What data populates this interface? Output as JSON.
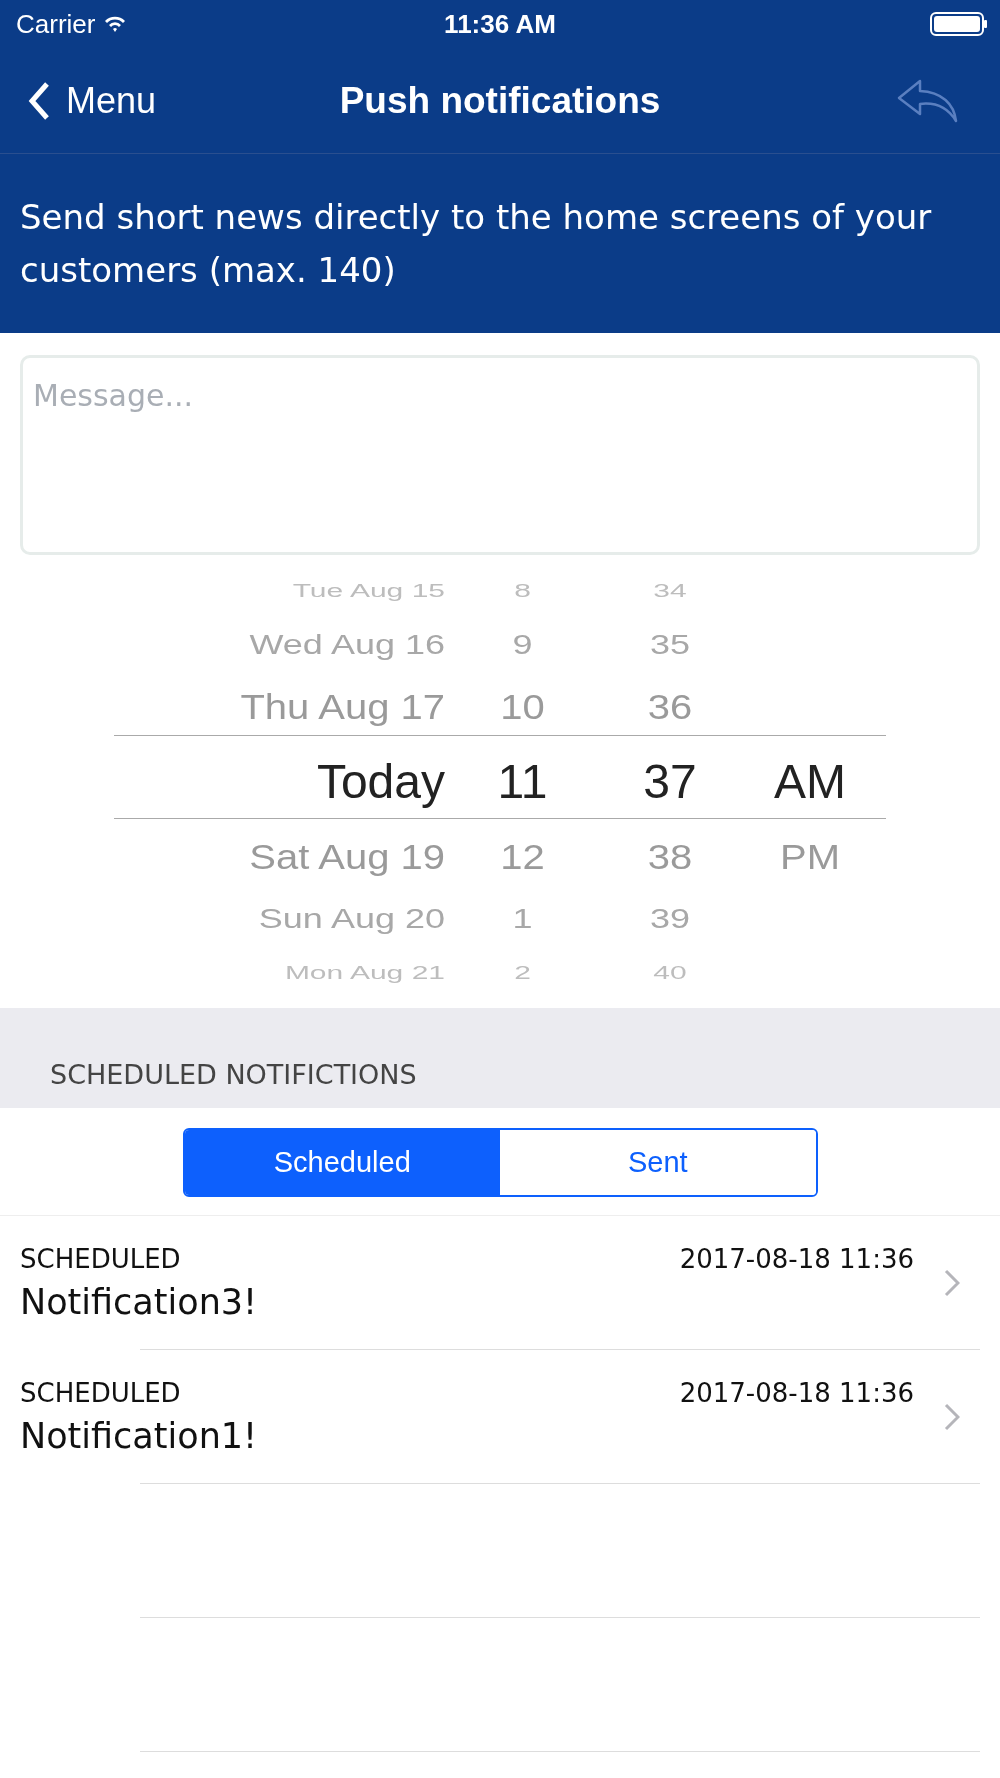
{
  "status_bar": {
    "carrier": "Carrier",
    "time": "11:36 AM"
  },
  "nav": {
    "back": "Menu",
    "title": "Push notifications"
  },
  "banner": "Send short news directly to the home screens of your customers (max. 140)",
  "message": {
    "placeholder": "Message..."
  },
  "picker": {
    "rows": [
      {
        "day": "Tue Aug 15",
        "hour": "8",
        "minute": "34",
        "period": "",
        "selected": false
      },
      {
        "day": "Wed Aug 16",
        "hour": "9",
        "minute": "35",
        "period": "",
        "selected": false
      },
      {
        "day": "Thu Aug 17",
        "hour": "10",
        "minute": "36",
        "period": "",
        "selected": false
      },
      {
        "day": "Today",
        "hour": "11",
        "minute": "37",
        "period": "AM",
        "selected": true
      },
      {
        "day": "Sat Aug 19",
        "hour": "12",
        "minute": "38",
        "period": "PM",
        "selected": false
      },
      {
        "day": "Sun Aug 20",
        "hour": "1",
        "minute": "39",
        "period": "",
        "selected": false
      },
      {
        "day": "Mon Aug 21",
        "hour": "2",
        "minute": "40",
        "period": "",
        "selected": false
      }
    ]
  },
  "section_header": "SCHEDULED NOTIFICTIONS",
  "tabs": [
    {
      "label": "Scheduled",
      "selected": true
    },
    {
      "label": "Sent",
      "selected": false
    }
  ],
  "notifications": [
    {
      "status": "SCHEDULED",
      "date": "2017-08-18 11:36",
      "title": "Notification3!"
    },
    {
      "status": "SCHEDULED",
      "date": "2017-08-18 11:36",
      "title": "Notification1!"
    }
  ]
}
